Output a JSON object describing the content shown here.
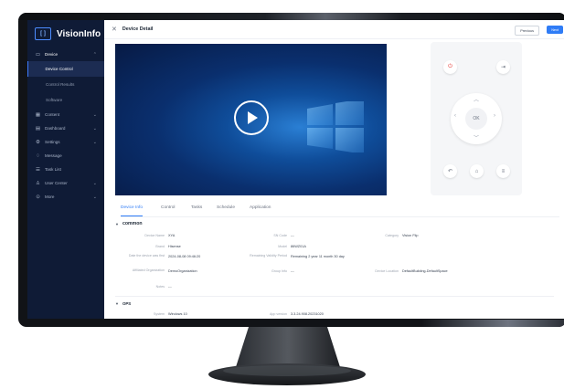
{
  "sidebar": {
    "brand": "VisionInfo",
    "logo_text": "[ ]",
    "items": [
      {
        "label": "Device",
        "icon": "device-icon"
      },
      {
        "label": "Device Control"
      },
      {
        "label": "Control Results"
      },
      {
        "label": "Software"
      },
      {
        "label": "Content",
        "icon": "content-icon"
      },
      {
        "label": "Dashboard",
        "icon": "dashboard-icon"
      },
      {
        "label": "Settings",
        "icon": "gear-icon"
      },
      {
        "label": "Message",
        "icon": "bell-icon"
      },
      {
        "label": "Task List",
        "icon": "list-icon"
      },
      {
        "label": "User Center",
        "icon": "user-icon"
      },
      {
        "label": "More",
        "icon": "more-icon"
      }
    ]
  },
  "header": {
    "title": "Device Detail",
    "prev_label": "Previous",
    "next_label": "Next"
  },
  "remote": {
    "ok_label": "OK"
  },
  "tabs": [
    "Device Info",
    "Control",
    "Tasks",
    "Schedule",
    "Application"
  ],
  "common": {
    "title": "common",
    "fields": {
      "device_name_label": "Device Name",
      "device_name": "XYA",
      "sn_label": "SN Code",
      "sn": "---",
      "category_label": "Category",
      "category": "Vision Flip",
      "brand_label": "Brand",
      "brand": "Hisense",
      "model_label": "Model",
      "model": "86WZ01A",
      "online_label": "Date the device was first",
      "online": "2024-08-08 09:46:20",
      "validity_label": "Remaining Validity Period",
      "validity": "Remaining 2 year 11 month 30 day",
      "org_label": "Affiliated Organization",
      "org": "DemoOrganization",
      "group_label": "Group Info",
      "group": "---",
      "location_label": "Device Location",
      "location": "DefaultBuilding-DefaultSpace",
      "notes_label": "Notes",
      "notes": "---"
    }
  },
  "ops": {
    "title": "OPS",
    "system_label": "System",
    "system": "Windows 10",
    "app_label": "App version",
    "app": "3.3.24.908.20231020"
  },
  "colors": {
    "sidebar_bg": "#0f1b36",
    "accent": "#2f7cf6"
  }
}
